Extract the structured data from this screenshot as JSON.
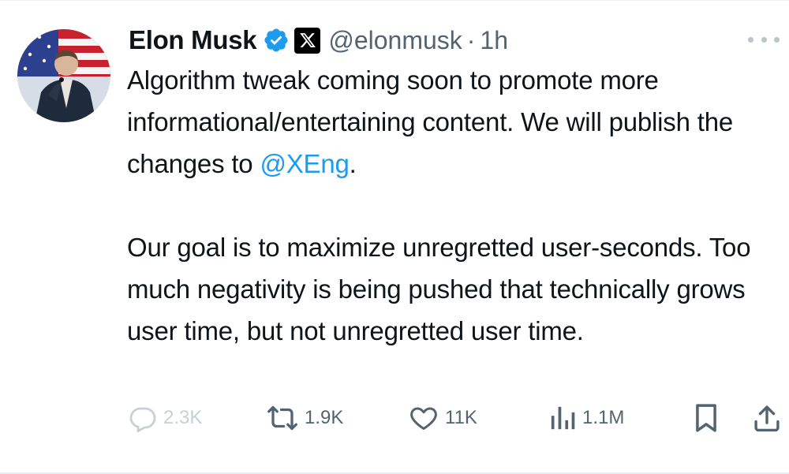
{
  "author": {
    "name": "Elon Musk",
    "handle": "@elonmusk",
    "separator": "·",
    "time": "1h"
  },
  "tweet": {
    "para1_pre": "Algorithm tweak coming soon to promote more informational/entertaining content. We will publish the changes to ",
    "mention": "@XEng",
    "para1_post": ".",
    "para2": "Our goal is to maximize unregretted user-seconds. Too much negativity is being pushed that technically grows user time, but not unregretted user time."
  },
  "actions": {
    "replies": "2.3K",
    "reposts": "1.9K",
    "likes": "11K",
    "views": "1.1M"
  },
  "icons": {
    "verified": "verified-badge-icon",
    "affiliate": "x-logo-icon",
    "more": "more-options-icon",
    "reply": "reply-icon",
    "repost": "repost-icon",
    "like": "heart-icon",
    "views": "views-chart-icon",
    "bookmark": "bookmark-icon",
    "share": "share-icon"
  },
  "colors": {
    "accent": "#1d9bf0",
    "text": "#0f1419",
    "secondary": "#536471"
  }
}
